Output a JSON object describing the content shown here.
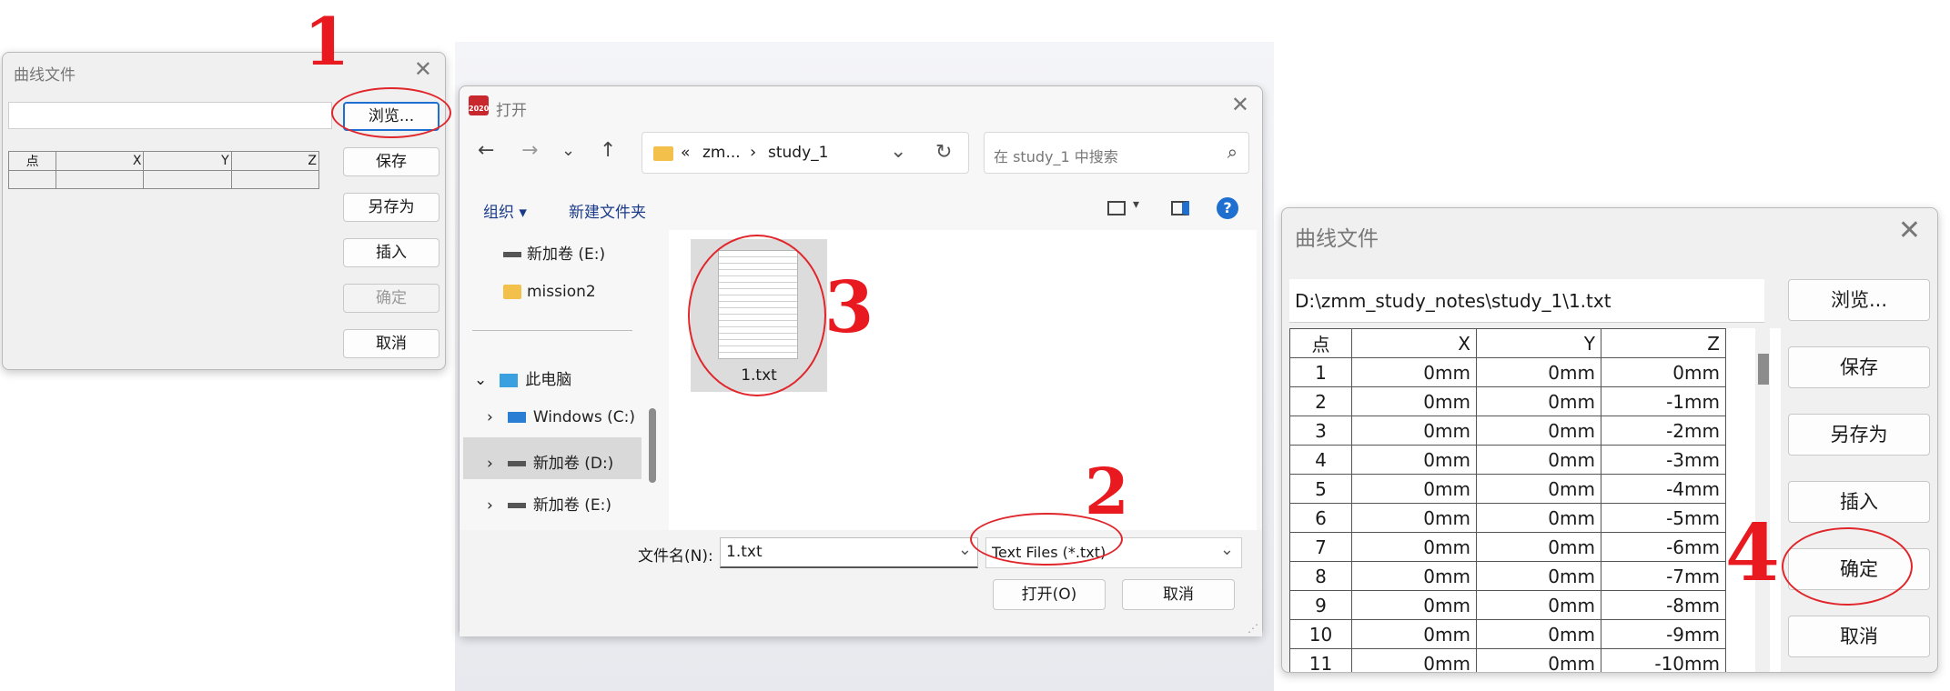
{
  "small_dialog": {
    "title": "曲线文件",
    "path_value": "",
    "grid_headers": [
      "点",
      "X",
      "Y",
      "Z"
    ],
    "buttons": {
      "browse": "浏览...",
      "save": "保存",
      "save_as": "另存为",
      "insert": "插入",
      "ok": "确定",
      "cancel": "取消"
    }
  },
  "open_dialog": {
    "title": "打开",
    "app_badge": "2020",
    "address": {
      "prefix": "«",
      "crumb1": "zm...",
      "separator": "›",
      "crumb2": "study_1"
    },
    "search_placeholder": "在 study_1 中搜索",
    "toolbar": {
      "organize": "组织 ▾",
      "new_folder": "新建文件夹"
    },
    "nav": {
      "items": [
        {
          "label": "新加卷 (E:)"
        },
        {
          "label": "mission2"
        },
        {
          "label": "此电脑"
        },
        {
          "label": "Windows (C:)"
        },
        {
          "label": "新加卷 (D:)"
        },
        {
          "label": "新加卷 (E:)"
        }
      ]
    },
    "file": {
      "name": "1.txt"
    },
    "filename_label": "文件名(N):",
    "filename_value": "1.txt",
    "filetype_value": "Text Files (*.txt)",
    "open_button": "打开(O)",
    "cancel_button": "取消"
  },
  "big_dialog": {
    "title": "曲线文件",
    "path_value": "D:\\zmm_study_notes\\study_1\\1.txt",
    "grid_headers": [
      "点",
      "X",
      "Y",
      "Z"
    ],
    "rows": [
      [
        "1",
        "0mm",
        "0mm",
        "0mm"
      ],
      [
        "2",
        "0mm",
        "0mm",
        "-1mm"
      ],
      [
        "3",
        "0mm",
        "0mm",
        "-2mm"
      ],
      [
        "4",
        "0mm",
        "0mm",
        "-3mm"
      ],
      [
        "5",
        "0mm",
        "0mm",
        "-4mm"
      ],
      [
        "6",
        "0mm",
        "0mm",
        "-5mm"
      ],
      [
        "7",
        "0mm",
        "0mm",
        "-6mm"
      ],
      [
        "8",
        "0mm",
        "0mm",
        "-7mm"
      ],
      [
        "9",
        "0mm",
        "0mm",
        "-8mm"
      ],
      [
        "10",
        "0mm",
        "0mm",
        "-9mm"
      ],
      [
        "11",
        "0mm",
        "0mm",
        "-10mm"
      ]
    ],
    "buttons": {
      "browse": "浏览...",
      "save": "保存",
      "save_as": "另存为",
      "insert": "插入",
      "ok": "确定",
      "cancel": "取消"
    }
  },
  "annotations": {
    "step1": "1",
    "step2": "2",
    "step3": "3",
    "step4": "4"
  },
  "colors": {
    "annotation": "#e8191f",
    "accent": "#1f6fd1",
    "folder": "#f2c04b",
    "help": "#1e6fd0"
  }
}
